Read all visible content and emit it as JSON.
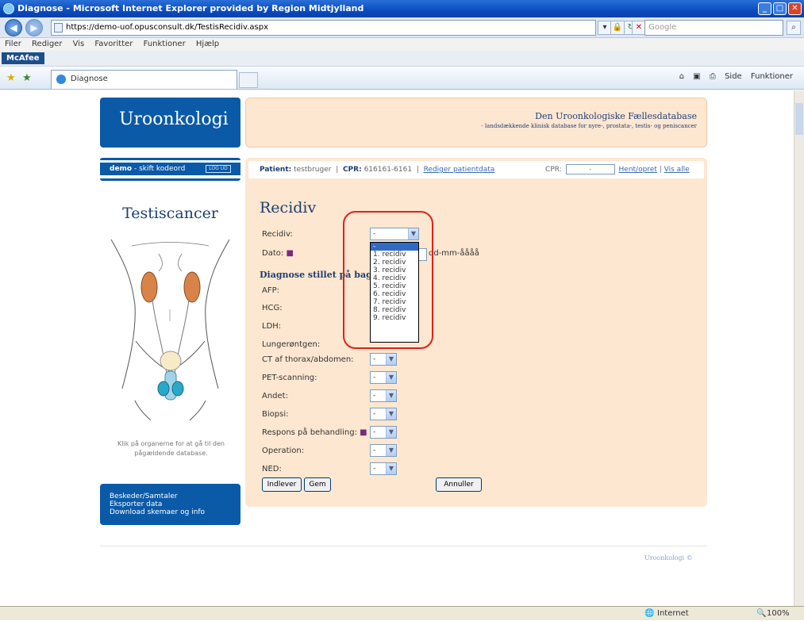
{
  "window": {
    "title": "Diagnose - Microsoft Internet Explorer provided by Region Midtjylland"
  },
  "browser": {
    "url": "https://demo-uof.opusconsult.dk/TestisRecidiv.aspx",
    "search_placeholder": "Google",
    "menu": [
      "Filer",
      "Rediger",
      "Vis",
      "Favoritter",
      "Funktioner",
      "Hjælp"
    ],
    "toolbar_addon": "McAfee",
    "tab_label": "Diagnose",
    "commands": [
      "Side",
      "Funktioner"
    ]
  },
  "site": {
    "logo": "Uroonkologi",
    "header_title": "Den Uroonkologiske Fællesdatabase",
    "header_subtitle": "- landsdækkende klinisk database for nyre-, prostata-, testis- og peniscancer",
    "user": "demo",
    "change_password": "skift kodeord",
    "logout": "LOG UD",
    "disease_title": "Testiscancer",
    "organ_hint": "Klik på organerne for at gå til den pågældende database.",
    "side_links": [
      "Beskeder/Samtaler",
      "Eksporter data",
      "Download skemaer og info"
    ],
    "footer": "Uroonkologi ©"
  },
  "patient_bar": {
    "patient_label": "Patient:",
    "patient_value": "testbruger",
    "cpr_label": "CPR:",
    "cpr_value": "616161-6161",
    "edit_link": "Rediger patientdata",
    "cpr_search_label": "CPR:",
    "cpr_input_value": "-",
    "fetch_link": "Hent/opret",
    "show_all_link": "Vis alle"
  },
  "form": {
    "title": "Recidiv",
    "recidiv_label": "Recidiv:",
    "recidiv_value": "-",
    "date_label": "Dato:",
    "date_format": "dd-mm-åååå",
    "subheading": "Diagnose stillet på baggrund af",
    "fields": [
      {
        "label": "AFP:"
      },
      {
        "label": "HCG:"
      },
      {
        "label": "LDH:"
      },
      {
        "label": "Lungerøntgen:"
      },
      {
        "label": "CT af thorax/abdomen:",
        "value": "-"
      },
      {
        "label": "PET-scanning:",
        "value": "-"
      },
      {
        "label": "Andet:",
        "value": "-"
      },
      {
        "label": "Biopsi:",
        "value": "-"
      },
      {
        "label": "Respons på behandling:",
        "value": "-"
      },
      {
        "label": "Operation:",
        "value": "-"
      },
      {
        "label": "NED:",
        "value": "-"
      }
    ],
    "dropdown_options": [
      "-",
      "1. recidiv",
      "2. recidiv",
      "3. recidiv",
      "4. recidiv",
      "5. recidiv",
      "6. recidiv",
      "7. recidiv",
      "8. recidiv",
      "9. recidiv"
    ],
    "buttons": {
      "submit": "Indlever",
      "save": "Gem",
      "cancel": "Annuller"
    }
  },
  "status": {
    "zone": "Internet",
    "zoom": "100%"
  },
  "colors": {
    "brand_blue": "#0a5aa8",
    "panel_peach": "#fde7d0",
    "highlight_circle": "#e0211c",
    "dropdown_highlight": "#316ac5"
  }
}
